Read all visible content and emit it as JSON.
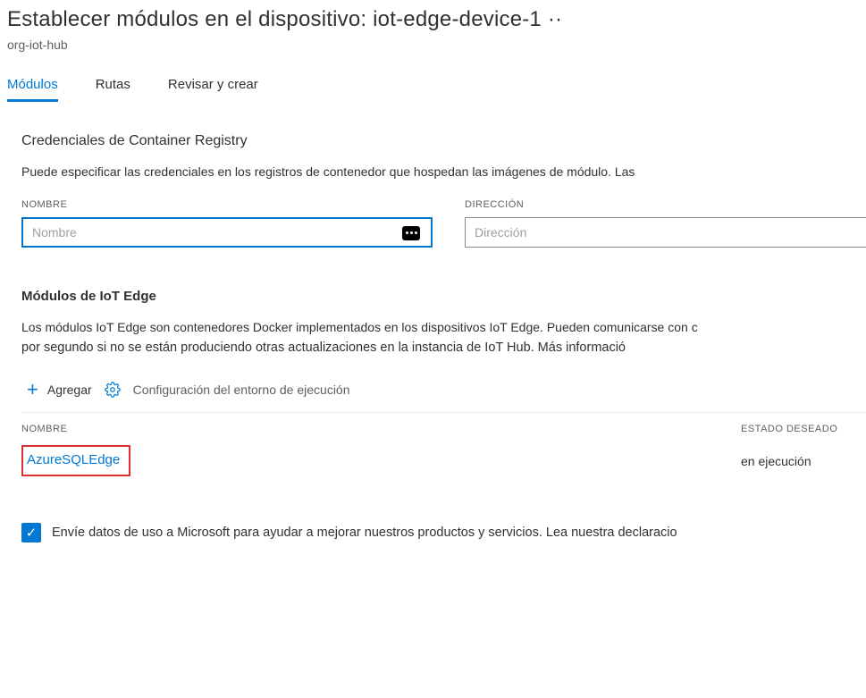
{
  "header": {
    "title": "Establecer módulos en el dispositivo: iot-edge-device-1 ··",
    "subtitle": "org-iot-hub"
  },
  "tabs": {
    "items": [
      {
        "label": "Módulos",
        "active": true
      },
      {
        "label": "Rutas",
        "active": false
      },
      {
        "label": "Revisar y  crear",
        "active": false
      }
    ]
  },
  "registry": {
    "title": "Credenciales de Container Registry",
    "description": "Puede especificar las credenciales en los registros de contenedor que hospedan las imágenes de módulo. Las",
    "name_label": "NOMBRE",
    "name_placeholder": "Nombre",
    "address_label": "DIRECCIÓN",
    "address_placeholder": "Dirección"
  },
  "modules": {
    "title": "Módulos de IoT Edge",
    "desc1": "Los módulos IoT Edge son contenedores Docker implementados en los dispositivos IoT Edge. Pueden comunicarse con c",
    "desc2": "por segundo si no se están produciendo otras actualizaciones en la instancia de IoT Hub. Más informació",
    "add_label": "Agregar",
    "runtime_label": "Configuración del entorno de ejecución",
    "columns": {
      "name": "NOMBRE",
      "state": "ESTADO DESEADO"
    },
    "rows": [
      {
        "name": "AzureSQLEdge",
        "state": "en ejecución"
      }
    ]
  },
  "usage": {
    "checked": true,
    "text": "Envíe datos de uso a Microsoft para ayudar a mejorar nuestros productos y servicios. Lea nuestra declaracio"
  }
}
